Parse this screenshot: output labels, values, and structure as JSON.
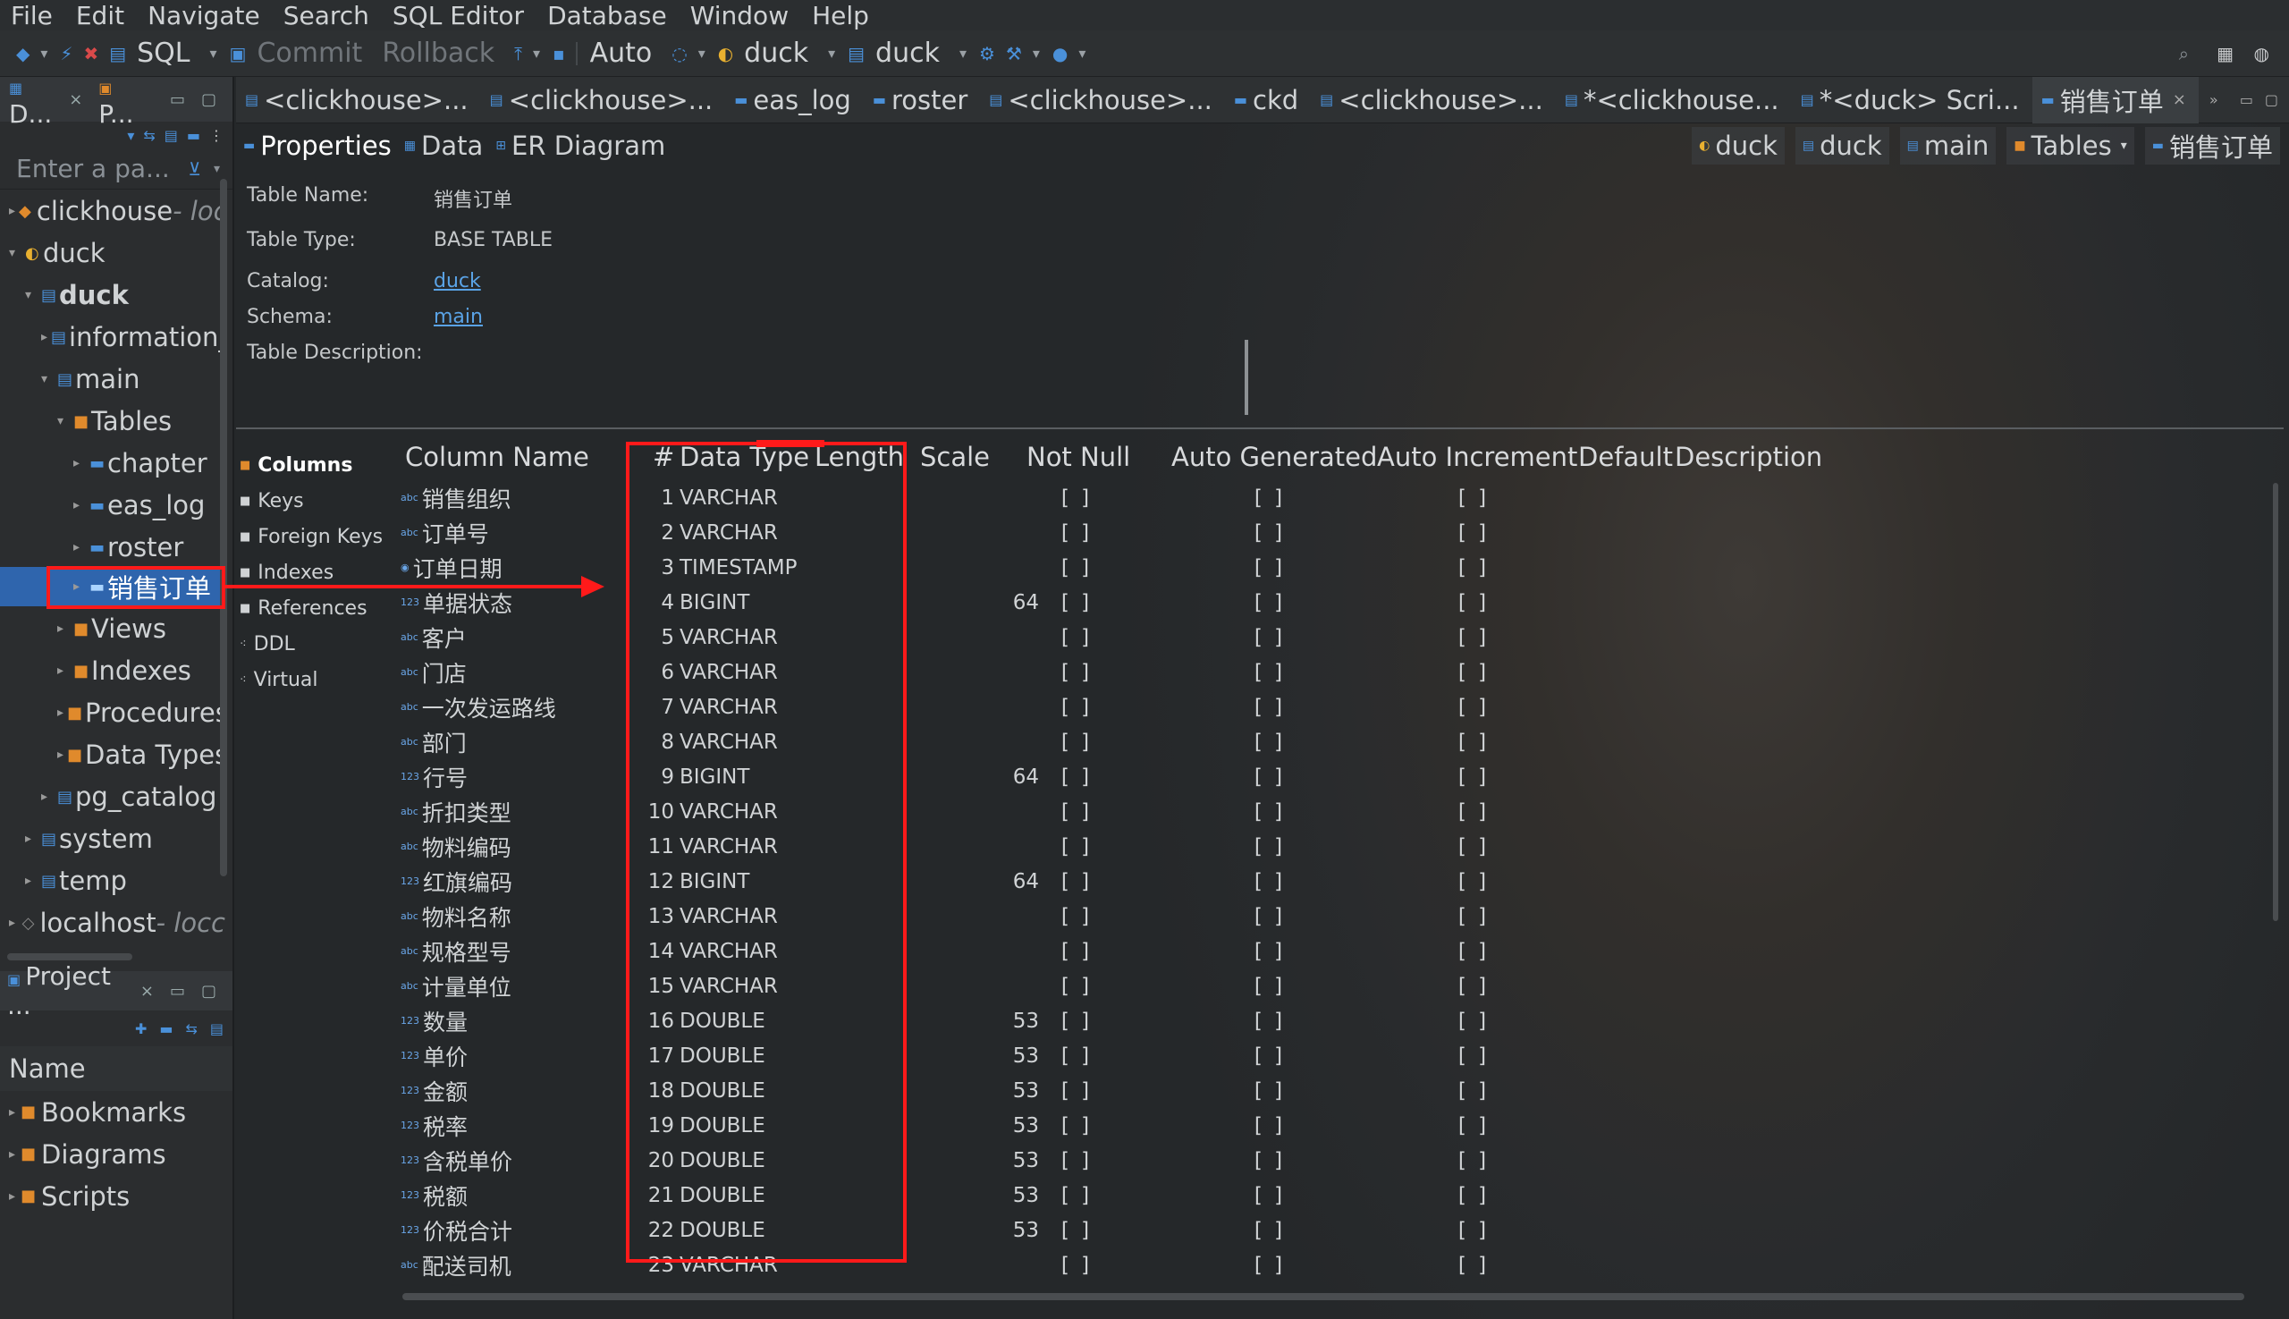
{
  "menu": [
    "File",
    "Edit",
    "Navigate",
    "Search",
    "SQL Editor",
    "Database",
    "Window",
    "Help"
  ],
  "toolbar": {
    "sql": "SQL",
    "commit": "Commit",
    "rollback": "Rollback",
    "mode": "Auto",
    "datasource": "duck",
    "schema": "duck"
  },
  "navigator": {
    "tabs": [
      "D...",
      "P..."
    ],
    "filter_placeholder": "Enter a pa...",
    "items": [
      {
        "label": "clickhouse",
        "sub": " - loc"
      },
      {
        "label": "duck"
      },
      {
        "label": "duck"
      },
      {
        "label": "information_"
      },
      {
        "label": "main"
      },
      {
        "label": "Tables"
      },
      {
        "label": "chapter"
      },
      {
        "label": "eas_log"
      },
      {
        "label": "roster"
      },
      {
        "label": "销售订单"
      },
      {
        "label": "Views"
      },
      {
        "label": "Indexes"
      },
      {
        "label": "Procedures"
      },
      {
        "label": "Data Types"
      },
      {
        "label": "pg_catalog"
      },
      {
        "label": "system"
      },
      {
        "label": "temp"
      },
      {
        "label": "localhost",
        "sub": " - locc"
      }
    ]
  },
  "project": {
    "tab": "Project ...",
    "header": "Name",
    "items": [
      "Bookmarks",
      "Diagrams",
      "Scripts"
    ]
  },
  "editor_tabs": [
    "<clickhouse>...",
    "<clickhouse>...",
    "eas_log",
    "roster",
    "<clickhouse>...",
    "ckd",
    "<clickhouse>...",
    "*<clickhouse...",
    "*<duck> Scri...",
    "销售订单"
  ],
  "sub_tabs": [
    "Properties",
    "Data",
    "ER Diagram"
  ],
  "breadcrumbs": [
    "duck",
    "duck",
    "main",
    "Tables",
    "销售订单"
  ],
  "properties": {
    "table_name_label": "Table Name:",
    "table_name": "销售订单",
    "table_type_label": "Table Type:",
    "table_type": "BASE TABLE",
    "catalog_label": "Catalog:",
    "catalog": "duck",
    "schema_label": "Schema:",
    "schema": "main",
    "description_label": "Table Description:"
  },
  "categories": [
    "Columns",
    "Keys",
    "Foreign Keys",
    "Indexes",
    "References",
    "DDL",
    "Virtual"
  ],
  "table": {
    "headers": {
      "column_name": "Column Name",
      "num": "#",
      "data_type": "Data Type",
      "length": "Length",
      "scale": "Scale",
      "not_null": "Not Null",
      "auto_generated": "Auto Generated",
      "auto_increment": "Auto Increment",
      "default": "Default",
      "description": "Description"
    },
    "rows": [
      {
        "name": "销售组织",
        "num": "1",
        "type": "VARCHAR",
        "scale": "",
        "nn": "[ ]",
        "ag": "[ ]",
        "ai": "[ ]"
      },
      {
        "name": "订单号",
        "num": "2",
        "type": "VARCHAR",
        "scale": "",
        "nn": "[ ]",
        "ag": "[ ]",
        "ai": "[ ]"
      },
      {
        "name": "订单日期",
        "num": "3",
        "type": "TIMESTAMP",
        "scale": "",
        "nn": "[ ]",
        "ag": "[ ]",
        "ai": "[ ]"
      },
      {
        "name": "单据状态",
        "num": "4",
        "type": "BIGINT",
        "scale": "64",
        "nn": "[ ]",
        "ag": "[ ]",
        "ai": "[ ]"
      },
      {
        "name": "客户",
        "num": "5",
        "type": "VARCHAR",
        "scale": "",
        "nn": "[ ]",
        "ag": "[ ]",
        "ai": "[ ]"
      },
      {
        "name": "门店",
        "num": "6",
        "type": "VARCHAR",
        "scale": "",
        "nn": "[ ]",
        "ag": "[ ]",
        "ai": "[ ]"
      },
      {
        "name": "一次发运路线",
        "num": "7",
        "type": "VARCHAR",
        "scale": "",
        "nn": "[ ]",
        "ag": "[ ]",
        "ai": "[ ]"
      },
      {
        "name": "部门",
        "num": "8",
        "type": "VARCHAR",
        "scale": "",
        "nn": "[ ]",
        "ag": "[ ]",
        "ai": "[ ]"
      },
      {
        "name": "行号",
        "num": "9",
        "type": "BIGINT",
        "scale": "64",
        "nn": "[ ]",
        "ag": "[ ]",
        "ai": "[ ]"
      },
      {
        "name": "折扣类型",
        "num": "10",
        "type": "VARCHAR",
        "scale": "",
        "nn": "[ ]",
        "ag": "[ ]",
        "ai": "[ ]"
      },
      {
        "name": "物料编码",
        "num": "11",
        "type": "VARCHAR",
        "scale": "",
        "nn": "[ ]",
        "ag": "[ ]",
        "ai": "[ ]"
      },
      {
        "name": "红旗编码",
        "num": "12",
        "type": "BIGINT",
        "scale": "64",
        "nn": "[ ]",
        "ag": "[ ]",
        "ai": "[ ]"
      },
      {
        "name": "物料名称",
        "num": "13",
        "type": "VARCHAR",
        "scale": "",
        "nn": "[ ]",
        "ag": "[ ]",
        "ai": "[ ]"
      },
      {
        "name": "规格型号",
        "num": "14",
        "type": "VARCHAR",
        "scale": "",
        "nn": "[ ]",
        "ag": "[ ]",
        "ai": "[ ]"
      },
      {
        "name": "计量单位",
        "num": "15",
        "type": "VARCHAR",
        "scale": "",
        "nn": "[ ]",
        "ag": "[ ]",
        "ai": "[ ]"
      },
      {
        "name": "数量",
        "num": "16",
        "type": "DOUBLE",
        "scale": "53",
        "nn": "[ ]",
        "ag": "[ ]",
        "ai": "[ ]"
      },
      {
        "name": "单价",
        "num": "17",
        "type": "DOUBLE",
        "scale": "53",
        "nn": "[ ]",
        "ag": "[ ]",
        "ai": "[ ]"
      },
      {
        "name": "金额",
        "num": "18",
        "type": "DOUBLE",
        "scale": "53",
        "nn": "[ ]",
        "ag": "[ ]",
        "ai": "[ ]"
      },
      {
        "name": "税率",
        "num": "19",
        "type": "DOUBLE",
        "scale": "53",
        "nn": "[ ]",
        "ag": "[ ]",
        "ai": "[ ]"
      },
      {
        "name": "含税单价",
        "num": "20",
        "type": "DOUBLE",
        "scale": "53",
        "nn": "[ ]",
        "ag": "[ ]",
        "ai": "[ ]"
      },
      {
        "name": "税额",
        "num": "21",
        "type": "DOUBLE",
        "scale": "53",
        "nn": "[ ]",
        "ag": "[ ]",
        "ai": "[ ]"
      },
      {
        "name": "价税合计",
        "num": "22",
        "type": "DOUBLE",
        "scale": "53",
        "nn": "[ ]",
        "ag": "[ ]",
        "ai": "[ ]"
      },
      {
        "name": "配送司机",
        "num": "23",
        "type": "VARCHAR",
        "scale": "",
        "nn": "[ ]",
        "ag": "[ ]",
        "ai": "[ ]"
      }
    ]
  },
  "colors": {
    "accent": "#2f65ad",
    "annotation": "#ff1a1a",
    "link": "#5aa3e6"
  }
}
